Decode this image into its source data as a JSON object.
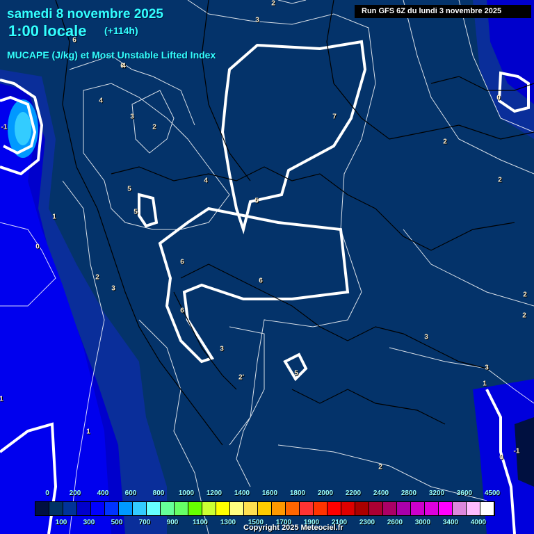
{
  "header": {
    "date": "samedi 8 novembre 2025",
    "time": "1:00 locale",
    "step": "(+114h)",
    "parameter": "MUCAPE (J/kg) et Most Unstable Lifted Index",
    "run": "Run GFS 6Z du lundi 3 novembre 2025"
  },
  "legend": {
    "values": [
      "0",
      "100",
      "200",
      "300",
      "400",
      "500",
      "600",
      "700",
      "800",
      "900",
      "1000",
      "1100",
      "1200",
      "1300",
      "1400",
      "1500",
      "1600",
      "1700",
      "1800",
      "1900",
      "2000",
      "2100",
      "2200",
      "2300",
      "2400",
      "2600",
      "2800",
      "3000",
      "3200",
      "3400",
      "3600",
      "4000",
      "4500"
    ],
    "colors": [
      "#001040",
      "#003366",
      "#003399",
      "#0000cc",
      "#0000ff",
      "#0033ff",
      "#0099ff",
      "#33ccff",
      "#66ffff",
      "#66ff99",
      "#66ff66",
      "#66ff00",
      "#ccff33",
      "#ffff00",
      "#ffff80",
      "#ffe050",
      "#ffcc00",
      "#ff9900",
      "#ff6600",
      "#ff3333",
      "#ff3300",
      "#ff0000",
      "#dd0000",
      "#aa0000",
      "#aa0033",
      "#aa0066",
      "#aa00aa",
      "#cc00cc",
      "#dd00dd",
      "#ff00ff",
      "#dd88dd",
      "#ffbbff",
      "#ffffff"
    ]
  },
  "map_labels": [
    "2",
    "3",
    "6",
    "6",
    "4",
    "4",
    "3",
    "2",
    "-1",
    "5",
    "5",
    "1",
    "0",
    "2",
    "3",
    "6",
    "6",
    "6",
    "5",
    "7",
    "4",
    "2",
    "2",
    "0",
    "3",
    "2'",
    "1",
    "5",
    "3",
    "3",
    "1",
    "2",
    "2",
    "0",
    "-1",
    "1",
    "2"
  ],
  "copyright": "Copyright 2025 Meteociel.fr"
}
